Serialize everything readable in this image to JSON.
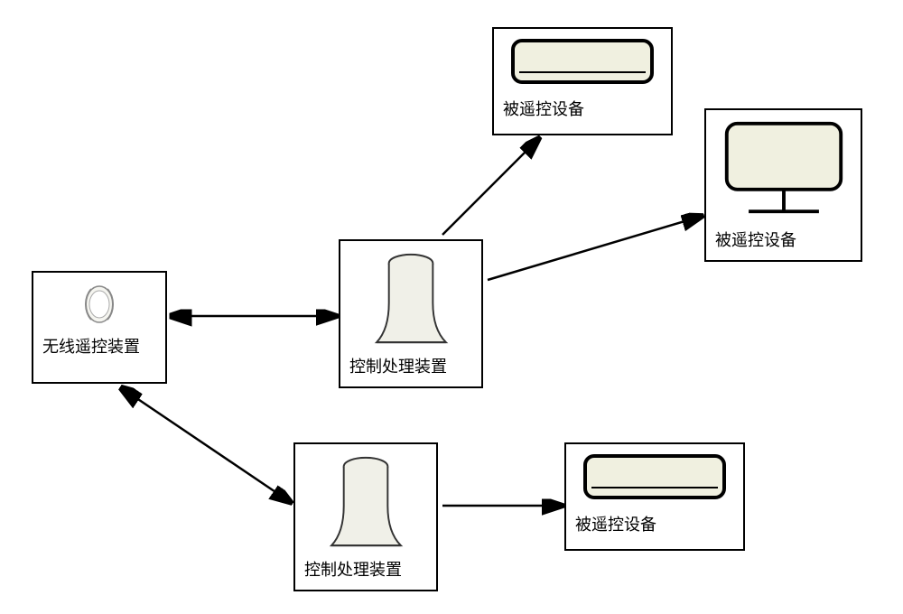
{
  "nodes": {
    "remote": {
      "label": "无线遥控装置"
    },
    "control_top": {
      "label": "控制处理装置"
    },
    "control_bottom": {
      "label": "控制处理装置"
    },
    "device_top": {
      "label": "被遥控设备"
    },
    "device_middle": {
      "label": "被遥控设备"
    },
    "device_bottom": {
      "label": "被遥控设备"
    }
  },
  "icons": {
    "remote": "watch-icon",
    "control": "cylinder-icon",
    "ac_unit": "ac-icon",
    "tv": "tv-icon"
  },
  "connections": [
    {
      "from": "remote",
      "to": "control_top",
      "bidirectional": true
    },
    {
      "from": "remote",
      "to": "control_bottom",
      "bidirectional": true
    },
    {
      "from": "control_top",
      "to": "device_top",
      "bidirectional": false
    },
    {
      "from": "control_top",
      "to": "device_middle",
      "bidirectional": false
    },
    {
      "from": "control_bottom",
      "to": "device_bottom",
      "bidirectional": false
    }
  ]
}
